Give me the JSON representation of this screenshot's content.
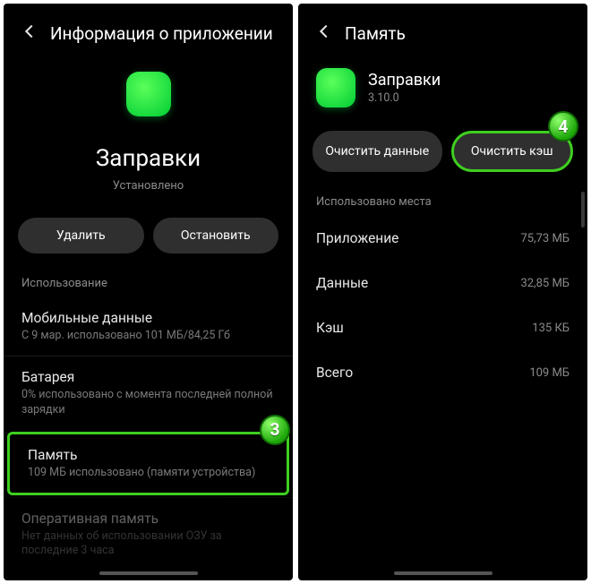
{
  "left": {
    "header_title": "Информация о приложении",
    "app_name": "Заправки",
    "app_status": "Установлено",
    "btn_uninstall": "Удалить",
    "btn_stop": "Остановить",
    "section_usage": "Использование",
    "items": [
      {
        "title": "Мобильные данные",
        "sub": "С 9 мар. использовано 101 МБ/84,25 Гб"
      },
      {
        "title": "Батарея",
        "sub": "0% использовано с момента последней полной зарядки"
      },
      {
        "title": "Память",
        "sub": "109 МБ использовано (памяти устройства)"
      },
      {
        "title": "Оперативная память",
        "sub": "Нет данных об использовании ОЗУ за последние 3 часа"
      }
    ],
    "badge3": "3"
  },
  "right": {
    "header_title": "Память",
    "app_name": "Заправки",
    "app_version": "3.10.0",
    "btn_clear_data": "Очистить данные",
    "btn_clear_cache": "Очистить кэш",
    "section_space": "Использовано места",
    "rows": [
      {
        "k": "Приложение",
        "v": "75,73 МБ"
      },
      {
        "k": "Данные",
        "v": "32,85 МБ"
      },
      {
        "k": "Кэш",
        "v": "135 КБ"
      },
      {
        "k": "Всего",
        "v": "109 МБ"
      }
    ],
    "badge4": "4"
  }
}
